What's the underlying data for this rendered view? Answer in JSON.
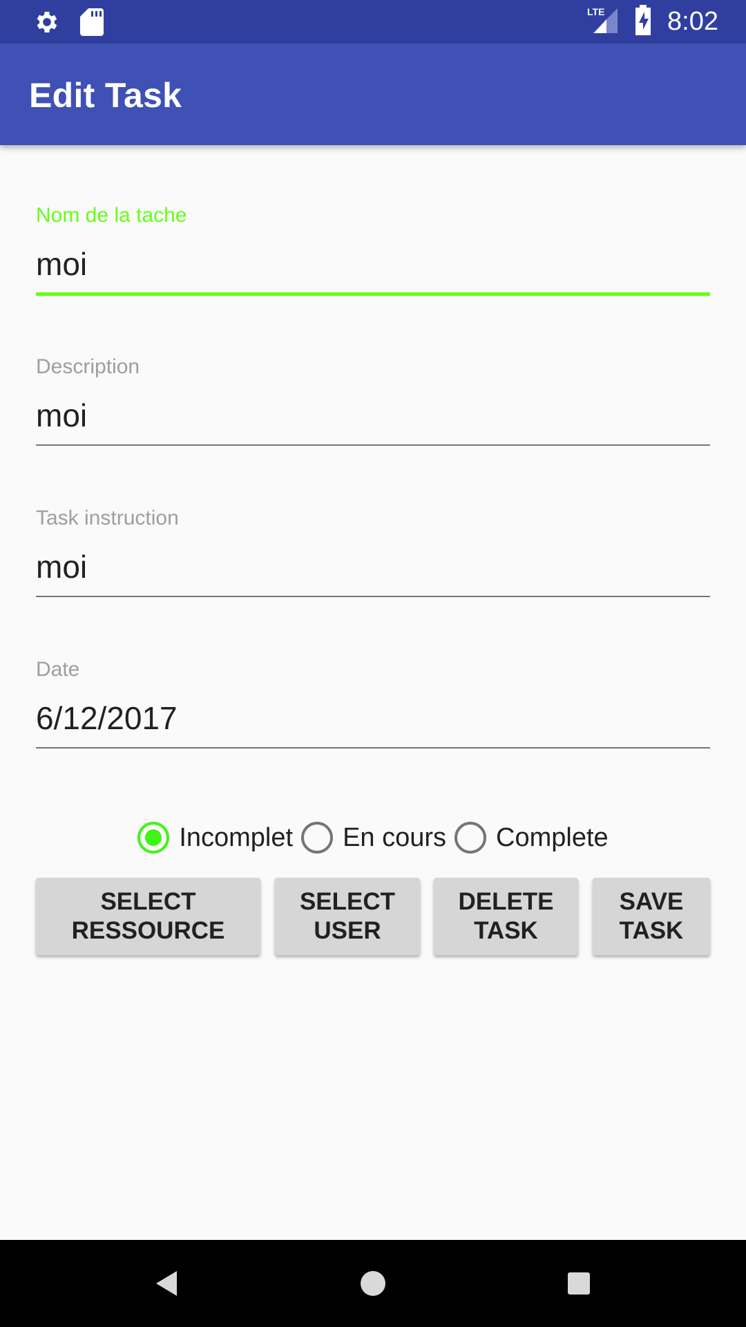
{
  "status_bar": {
    "time": "8:02",
    "network": "LTE",
    "icons": [
      "settings-icon",
      "sd-card-icon",
      "lte-signal-icon",
      "battery-charging-icon"
    ]
  },
  "app_bar": {
    "title": "Edit Task"
  },
  "form": {
    "fields": [
      {
        "label": "Nom de la tache",
        "value": "moi",
        "focused": true
      },
      {
        "label": "Description",
        "value": "moi",
        "focused": false
      },
      {
        "label": "Task instruction",
        "value": "moi",
        "focused": false
      },
      {
        "label": "Date",
        "value": "6/12/2017",
        "focused": false
      }
    ]
  },
  "status_radio": {
    "options": [
      "Incomplet",
      "En cours",
      "Complete"
    ],
    "selected": "Incomplet"
  },
  "buttons": {
    "select_ressource": "SELECT\nRESSOURCE",
    "select_user": "SELECT\nUSER",
    "delete_task": "DELETE\nTASK",
    "save_task": "SAVE\nTASK"
  },
  "colors": {
    "status_bar": "#303f9f",
    "app_bar": "#3f51b5",
    "accent": "#64ff16",
    "button": "#d6d6d6"
  },
  "nav_bar": {
    "icons": [
      "back-icon",
      "home-icon",
      "recents-icon"
    ]
  }
}
